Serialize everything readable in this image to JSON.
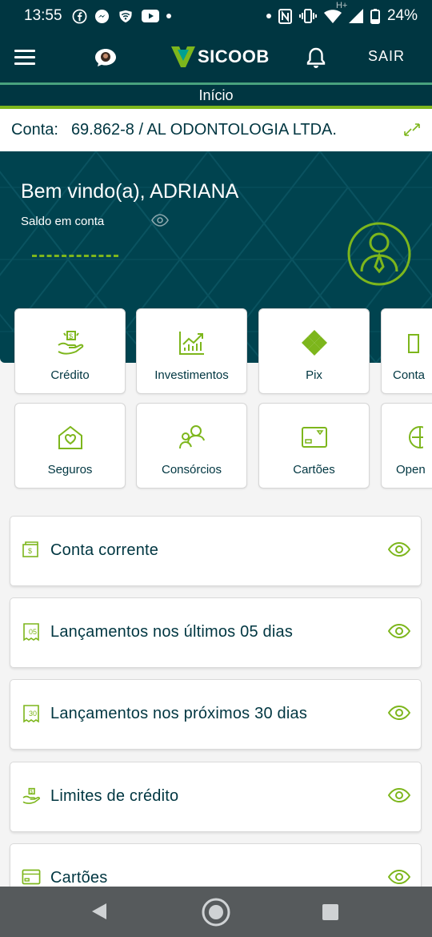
{
  "status_bar": {
    "time": "13:55",
    "battery": "24%",
    "network_type": "H+",
    "left_icons": [
      "facebook-icon",
      "messenger-icon",
      "shield-wifi-icon",
      "youtube-icon",
      "dot-icon"
    ],
    "right_icons": [
      "dot-icon",
      "nfc-icon",
      "vibrate-icon",
      "wifi-icon",
      "signal-icon",
      "battery-icon"
    ]
  },
  "header": {
    "menu_icon": "hamburger-icon",
    "chat_icon": "chat-avatar-icon",
    "logo_text": "SICOOB",
    "bell_icon": "bell-icon",
    "logout_label": "SAIR"
  },
  "page": {
    "title": "Início"
  },
  "account": {
    "label": "Conta:",
    "value": "69.862-8 / AL ODONTOLOGIA LTDA."
  },
  "hero": {
    "welcome": "Bem vindo(a), ADRIANA",
    "balance_label": "Saldo em conta",
    "balance_hidden": true
  },
  "quick_actions": [
    {
      "label": "Crédito",
      "icon": "credit-hand-icon"
    },
    {
      "label": "Investimentos",
      "icon": "chart-icon"
    },
    {
      "label": "Pix",
      "icon": "pix-icon"
    },
    {
      "label": "Conta",
      "icon": "account-icon"
    },
    {
      "label": "Seguros",
      "icon": "house-heart-icon"
    },
    {
      "label": "Consórcios",
      "icon": "people-icon"
    },
    {
      "label": "Cartões",
      "icon": "card-icon"
    },
    {
      "label": "Open",
      "icon": "open-icon"
    }
  ],
  "cards": [
    {
      "title": "Conta corrente",
      "icon": "wallet-icon"
    },
    {
      "title": "Lançamentos nos últimos 05 dias",
      "icon": "receipt-05-icon",
      "badge": "05"
    },
    {
      "title": "Lançamentos nos próximos 30 dias",
      "icon": "receipt-30-icon",
      "badge": "30"
    },
    {
      "title": "Limites de crédito",
      "icon": "credit-hand-icon"
    },
    {
      "title": "Cartões",
      "icon": "card-icon"
    }
  ],
  "colors": {
    "primary": "#003641",
    "hero": "#00434f",
    "accent": "#7db61c",
    "teal": "#49a27e",
    "nav": "#565a5c"
  }
}
